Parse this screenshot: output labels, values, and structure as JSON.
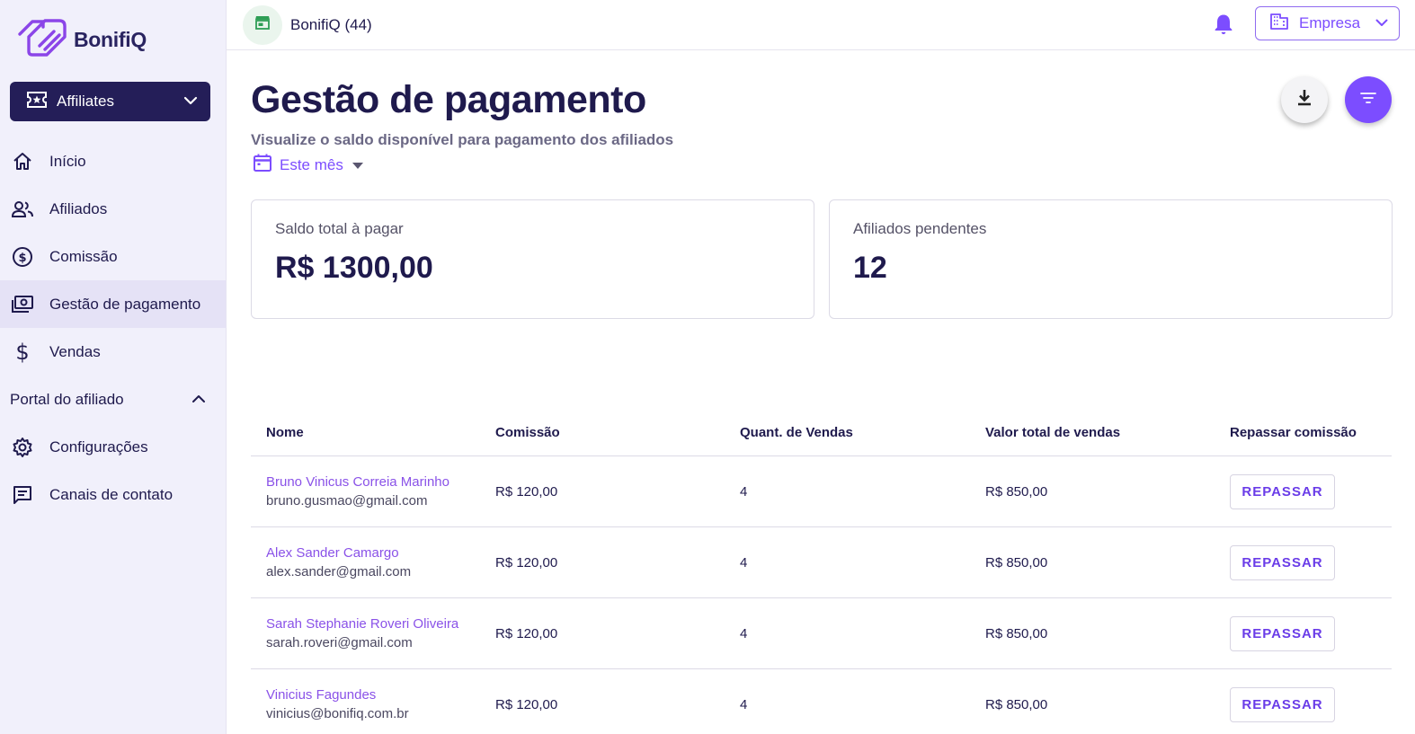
{
  "sidebar": {
    "logo_text": "BonifiQ",
    "workspace_label": "Affiliates",
    "items": [
      {
        "label": "Início",
        "icon": "home-icon"
      },
      {
        "label": "Afiliados",
        "icon": "users-icon"
      },
      {
        "label": "Comissão",
        "icon": "dollar-circle-icon"
      },
      {
        "label": "Gestão de pagamento",
        "icon": "payments-icon",
        "active": true
      },
      {
        "label": "Vendas",
        "icon": "dollar-icon"
      }
    ],
    "section_label": "Portal do afiliado",
    "section_items": [
      {
        "label": "Configurações",
        "icon": "gear-icon"
      },
      {
        "label": "Canais de contato",
        "icon": "chat-icon"
      }
    ]
  },
  "topbar": {
    "store_name": "BonifiQ (44)",
    "company_label": "Empresa"
  },
  "page": {
    "title": "Gestão de pagamento",
    "subtitle": "Visualize o saldo disponível para pagamento dos afiliados",
    "period": "Este mês"
  },
  "cards": [
    {
      "label": "Saldo total à pagar",
      "value": "R$ 1300,00"
    },
    {
      "label": "Afiliados pendentes",
      "value": "12"
    }
  ],
  "table": {
    "headers": [
      "Nome",
      "Comissão",
      "Quant. de Vendas",
      "Valor total de vendas",
      "Repassar comissão"
    ],
    "rows": [
      {
        "name": "Bruno Vinicus Correia Marinho",
        "email": "bruno.gusmao@gmail.com",
        "commission": "R$ 120,00",
        "sales_count": "4",
        "sales_total": "R$ 850,00",
        "action": "REPASSAR"
      },
      {
        "name": "Alex Sander Camargo",
        "email": "alex.sander@gmail.com",
        "commission": "R$ 120,00",
        "sales_count": "4",
        "sales_total": "R$ 850,00",
        "action": "REPASSAR"
      },
      {
        "name": "Sarah Stephanie Roveri Oliveira",
        "email": "sarah.roveri@gmail.com",
        "commission": "R$ 120,00",
        "sales_count": "4",
        "sales_total": "R$ 850,00",
        "action": "REPASSAR"
      },
      {
        "name": "Vinicius Fagundes",
        "email": "vinicius@bonifiq.com.br",
        "commission": "R$ 120,00",
        "sales_count": "4",
        "sales_total": "R$ 850,00",
        "action": "REPASSAR"
      }
    ]
  },
  "colors": {
    "accent": "#7c4dff",
    "navy": "#241e58",
    "sidebar_bg": "#f1f0fb"
  }
}
